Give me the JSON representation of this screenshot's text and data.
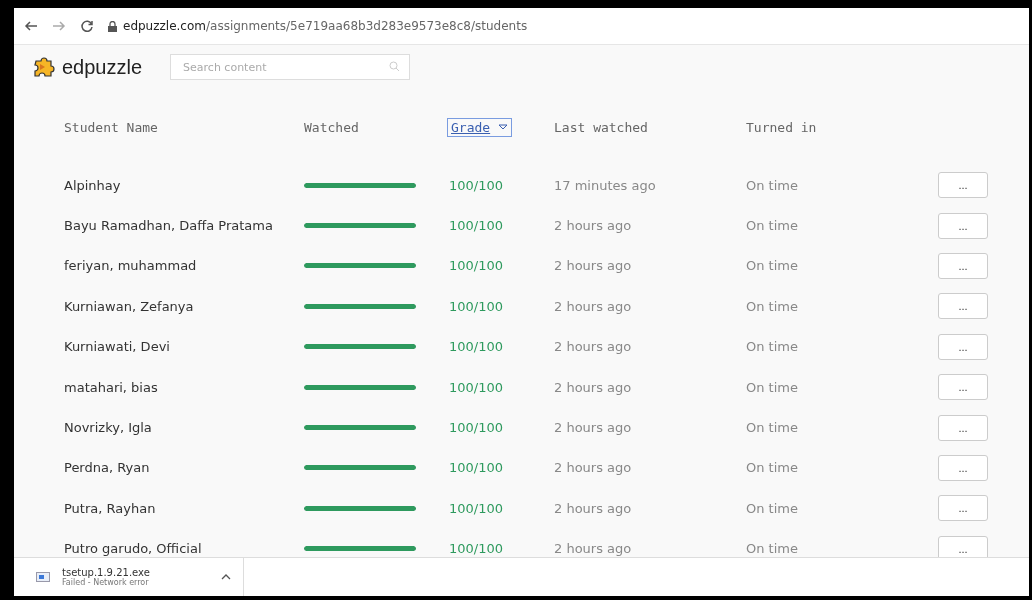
{
  "browser": {
    "url_host": "edpuzzle.com",
    "url_path": "/assignments/5e719aa68b3d283e9573e8c8/students"
  },
  "header": {
    "logo": "edpuzzle",
    "search": {
      "placeholder": "Search content"
    }
  },
  "table": {
    "columns": [
      {
        "label": "Student Name",
        "kind": "plain"
      },
      {
        "label": "Watched",
        "kind": "plain"
      },
      {
        "label": "Grade",
        "kind": "sort"
      },
      {
        "label": "Last watched",
        "kind": "plain"
      },
      {
        "label": "Turned in",
        "kind": "plain"
      }
    ],
    "rows": [
      {
        "name": "Alpinhay",
        "level": 1,
        "grade": "100/100",
        "last_watched": "17 minutes ago",
        "turned_in": "On time",
        "menu": "..."
      },
      {
        "name": "Bayu Ramadhan, Daffa Pratama",
        "level": 1,
        "grade": "100/100",
        "last_watched": "2 hours ago",
        "turned_in": "On time",
        "menu": "..."
      },
      {
        "name": "feriyan, muhammad",
        "level": 1,
        "grade": "100/100",
        "last_watched": "2 hours ago",
        "turned_in": "On time",
        "menu": "..."
      },
      {
        "name": "Kurniawan, Zefanya",
        "level": 1,
        "grade": "100/100",
        "last_watched": "2 hours ago",
        "turned_in": "On time",
        "menu": "..."
      },
      {
        "name": "Kurniawati, Devi",
        "level": 1,
        "grade": "100/100",
        "last_watched": "2 hours ago",
        "turned_in": "On time",
        "menu": "..."
      },
      {
        "name": "matahari, bias",
        "level": 1,
        "grade": "100/100",
        "last_watched": "2 hours ago",
        "turned_in": "On time",
        "menu": "..."
      },
      {
        "name": "Novrizky, Igla",
        "level": 1,
        "grade": "100/100",
        "last_watched": "2 hours ago",
        "turned_in": "On time",
        "menu": "..."
      },
      {
        "name": "Perdna, Ryan",
        "level": 1,
        "grade": "100/100",
        "last_watched": "2 hours ago",
        "turned_in": "On time",
        "menu": "..."
      },
      {
        "name": "Putra, Rayhan",
        "level": 1,
        "grade": "100/100",
        "last_watched": "2 hours ago",
        "turned_in": "On time",
        "menu": "..."
      },
      {
        "name": "Putro garudo, Official",
        "level": 1,
        "grade": "100/100",
        "last_watched": "2 hours ago",
        "turned_in": "On time",
        "menu": "..."
      }
    ]
  },
  "download_bar": {
    "file": "tsetup.1.9.21.exe",
    "status": "Failed - Network error"
  }
}
